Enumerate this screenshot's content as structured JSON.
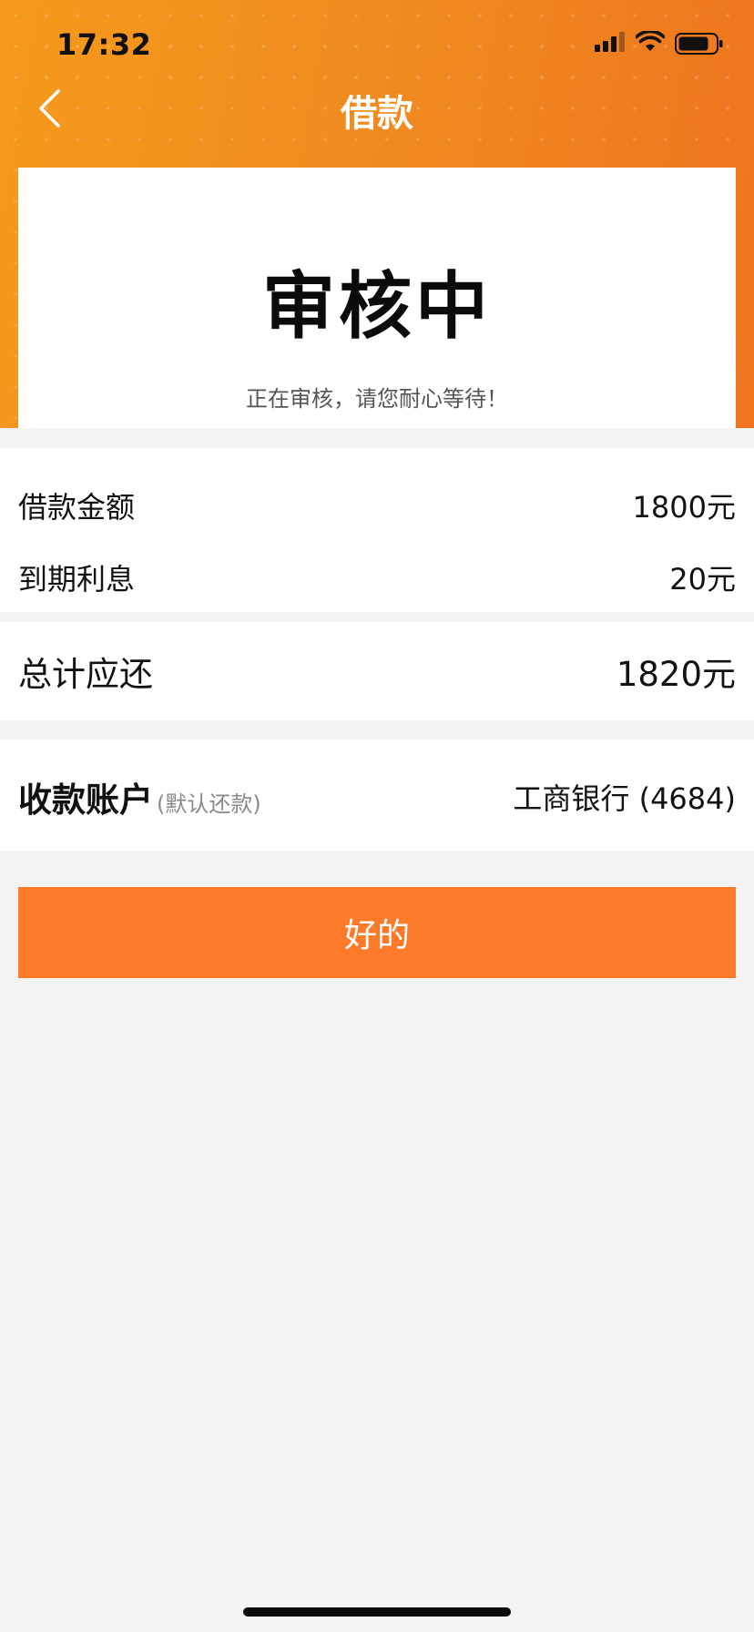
{
  "status_bar": {
    "time": "17:32"
  },
  "nav": {
    "title": "借款",
    "back_icon": "chevron-left-icon"
  },
  "review": {
    "status_title": "审核中",
    "status_subtitle": "正在审核，请您耐心等待！"
  },
  "loan": {
    "amount_label": "借款金额",
    "amount_value": "1800元",
    "interest_label": "到期利息",
    "interest_value": "20元"
  },
  "total": {
    "label": "总计应还",
    "value": "1820元"
  },
  "account": {
    "label": "收款账户",
    "hint": "(默认还款)",
    "value": "工商银行 (4684)"
  },
  "actions": {
    "ok_label": "好的"
  },
  "colors": {
    "header_gradient_start": "#f59a1b",
    "header_gradient_end": "#ee741f",
    "button": "#fc7a2a",
    "background": "#f3f3f3"
  }
}
